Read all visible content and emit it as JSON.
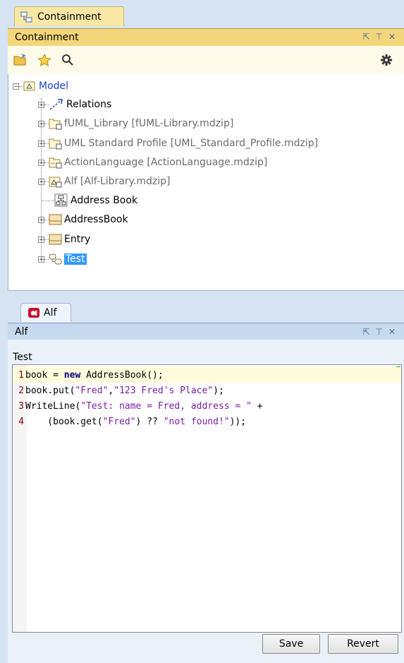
{
  "containment": {
    "tab_label": "Containment",
    "panel_title": "Containment",
    "header_controls": [
      "↗",
      "↗",
      "×"
    ],
    "toolbar": {
      "icons": [
        "open-folder-icon",
        "star-icon",
        "search-icon",
        "gear-icon"
      ]
    },
    "tree": {
      "root": "Model",
      "items": [
        {
          "label": "Relations",
          "icon": "relations-icon",
          "style": "normal"
        },
        {
          "label": "fUML_Library [fUML-Library.mdzip]",
          "icon": "package-lock-icon",
          "style": "gray"
        },
        {
          "label": "UML Standard Profile [UML_Standard_Profile.mdzip]",
          "icon": "package-lock-icon",
          "style": "gray"
        },
        {
          "label": "ActionLanguage [ActionLanguage.mdzip]",
          "icon": "profile-lock-icon",
          "style": "gray"
        },
        {
          "label": "Alf [Alf-Library.mdzip]",
          "icon": "model-lock-icon",
          "style": "gray"
        },
        {
          "label": "Address Book",
          "icon": "diagram-icon",
          "style": "normal"
        },
        {
          "label": "AddressBook",
          "icon": "class-icon",
          "style": "normal"
        },
        {
          "label": "Entry",
          "icon": "class-icon",
          "style": "normal"
        },
        {
          "label": "Test",
          "icon": "activity-icon",
          "style": "selected"
        }
      ]
    }
  },
  "alf": {
    "tab_label": "Alf",
    "panel_title": "Alf",
    "header_controls": [
      "↗",
      "↗",
      "×"
    ],
    "editor_label": "Test",
    "lines": [
      {
        "num": "1",
        "parts": [
          [
            "plain",
            "book = "
          ],
          [
            "kw",
            "new"
          ],
          [
            "plain",
            " AddressBook();"
          ]
        ]
      },
      {
        "num": "2",
        "parts": [
          [
            "plain",
            "book.put("
          ],
          [
            "str",
            "\"Fred\""
          ],
          [
            "plain",
            ","
          ],
          [
            "str",
            "\"123 Fred's Place\""
          ],
          [
            "plain",
            ");"
          ]
        ]
      },
      {
        "num": "3",
        "parts": [
          [
            "plain",
            "WriteLine("
          ],
          [
            "str",
            "\"Test: name = Fred, address = \""
          ],
          [
            "plain",
            " +"
          ]
        ]
      },
      {
        "num": "4",
        "parts": [
          [
            "plain",
            "    (book.get("
          ],
          [
            "str",
            "\"Fred\""
          ],
          [
            "plain",
            ") ?? "
          ],
          [
            "str",
            "\"not found!\""
          ],
          [
            "plain",
            "));"
          ]
        ]
      }
    ],
    "buttons": {
      "save": "Save",
      "revert": "Revert"
    }
  }
}
